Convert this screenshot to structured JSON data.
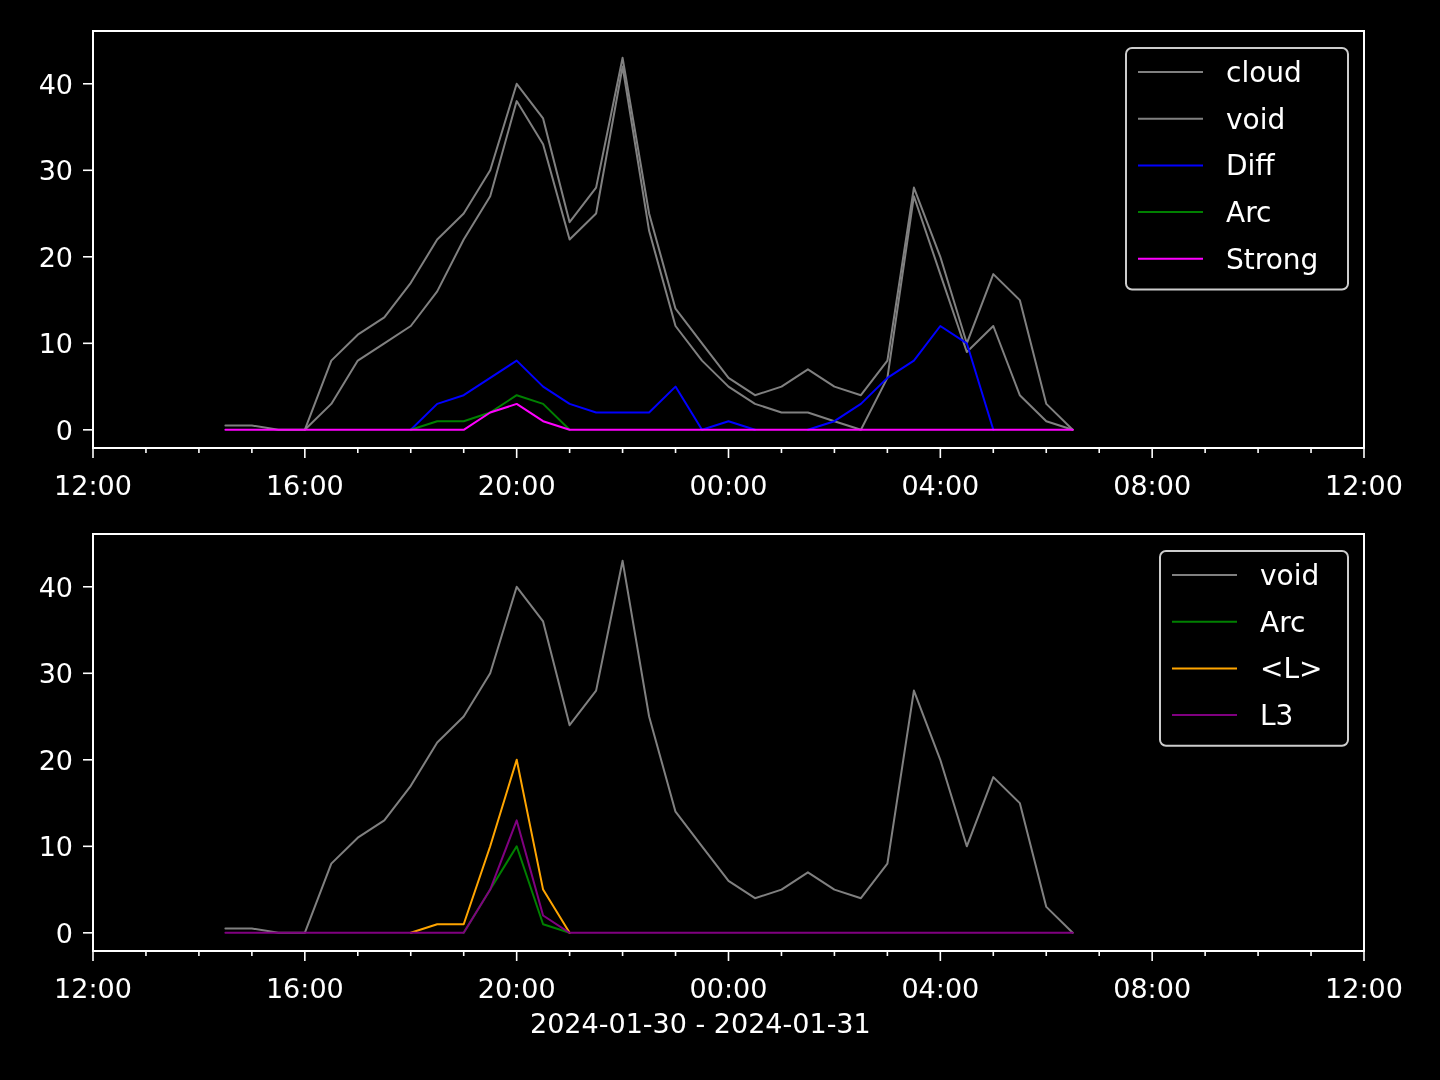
{
  "charts": [
    {
      "chart_data": {
        "type": "line",
        "ylim": [
          -2.1,
          46.1
        ],
        "legend": true,
        "categories": [
          "12:00",
          null,
          null,
          null,
          null,
          null,
          null,
          null,
          "16:00",
          null,
          null,
          null,
          null,
          null,
          null,
          null,
          "20:00",
          null,
          null,
          null,
          null,
          null,
          null,
          null,
          "00:00",
          null,
          null,
          null,
          null,
          null,
          null,
          null,
          "04:00",
          null,
          null,
          null,
          null,
          null,
          null,
          null,
          "08:00",
          null,
          null,
          null,
          null,
          null,
          null,
          null,
          "12:00"
        ],
        "yticks": [
          0,
          10,
          20,
          30,
          40
        ],
        "series": [
          {
            "name": "cloud",
            "color": "#808080",
            "values": [
              null,
              null,
              null,
              null,
              null,
              null,
              null,
              null,
              0,
              3,
              8,
              10,
              12,
              16,
              22,
              27,
              38,
              33,
              22,
              25,
              42,
              23,
              12,
              8,
              5,
              3,
              2,
              2,
              1,
              0,
              6,
              27,
              18,
              9,
              12,
              4,
              1,
              0,
              null,
              null,
              null,
              null,
              null,
              null,
              null,
              null,
              null,
              null,
              null
            ]
          },
          {
            "name": "void",
            "color": "#808080",
            "values": [
              null,
              null,
              null,
              null,
              null,
              0.5,
              0.5,
              0,
              0,
              8,
              11,
              13,
              17,
              22,
              25,
              30,
              40,
              36,
              24,
              28,
              43,
              25,
              14,
              10,
              6,
              4,
              5,
              7,
              5,
              4,
              8,
              28,
              20,
              10,
              18,
              15,
              3,
              0,
              null,
              null,
              null,
              null,
              null,
              null,
              null,
              null,
              null,
              null,
              null
            ]
          },
          {
            "name": "Diff",
            "color": "#0000ff",
            "values": [
              null,
              null,
              null,
              null,
              null,
              null,
              null,
              null,
              null,
              null,
              null,
              null,
              0,
              3,
              4,
              6,
              8,
              5,
              3,
              2,
              2,
              2,
              5,
              0,
              1,
              0,
              null,
              0,
              1,
              3,
              6,
              8,
              12,
              10,
              0,
              null,
              null,
              null,
              null,
              null,
              null,
              null,
              null,
              null,
              null,
              null,
              null,
              null,
              null
            ]
          },
          {
            "name": "Arc",
            "color": "#008000",
            "values": [
              null,
              null,
              null,
              null,
              null,
              null,
              null,
              null,
              null,
              null,
              null,
              null,
              0,
              1,
              1,
              2,
              4,
              3,
              0,
              null,
              null,
              null,
              null,
              null,
              null,
              null,
              null,
              null,
              null,
              null,
              null,
              null,
              null,
              null,
              null,
              null,
              null,
              null,
              null,
              null,
              null,
              null,
              null,
              null,
              null,
              null,
              null,
              null,
              null
            ]
          },
          {
            "name": "Strong",
            "color": "#ff00ff",
            "values": [
              null,
              null,
              null,
              null,
              null,
              0,
              0,
              0,
              0,
              0,
              0,
              0,
              0,
              0,
              0,
              2,
              3,
              1,
              0,
              0,
              0,
              0,
              0,
              0,
              0,
              0,
              0,
              0,
              0,
              0,
              0,
              0,
              0,
              0,
              0,
              0,
              0,
              0,
              null,
              null,
              null,
              null,
              null,
              null,
              null,
              null,
              null,
              null,
              null
            ]
          }
        ]
      }
    },
    {
      "chart_data": {
        "type": "line",
        "xlabel": "2024-01-30 - 2024-01-31",
        "ylim": [
          -2.1,
          46.1
        ],
        "legend": true,
        "categories": [
          "12:00",
          null,
          null,
          null,
          null,
          null,
          null,
          null,
          "16:00",
          null,
          null,
          null,
          null,
          null,
          null,
          null,
          "20:00",
          null,
          null,
          null,
          null,
          null,
          null,
          null,
          "00:00",
          null,
          null,
          null,
          null,
          null,
          null,
          null,
          "04:00",
          null,
          null,
          null,
          null,
          null,
          null,
          null,
          "08:00",
          null,
          null,
          null,
          null,
          null,
          null,
          null,
          "12:00"
        ],
        "yticks": [
          0,
          10,
          20,
          30,
          40
        ],
        "series": [
          {
            "name": "void",
            "color": "#808080",
            "values": [
              null,
              null,
              null,
              null,
              null,
              0.5,
              0.5,
              0,
              0,
              8,
              11,
              13,
              17,
              22,
              25,
              30,
              40,
              36,
              24,
              28,
              43,
              25,
              14,
              10,
              6,
              4,
              5,
              7,
              5,
              4,
              8,
              28,
              20,
              10,
              18,
              15,
              3,
              0,
              null,
              null,
              null,
              null,
              null,
              null,
              null,
              null,
              null,
              null,
              null
            ]
          },
          {
            "name": "Arc",
            "color": "#008000",
            "values": [
              null,
              null,
              null,
              null,
              null,
              null,
              null,
              null,
              null,
              null,
              null,
              null,
              null,
              null,
              0,
              5,
              10,
              1,
              0,
              null,
              null,
              null,
              null,
              null,
              null,
              null,
              null,
              null,
              null,
              null,
              null,
              null,
              null,
              null,
              null,
              null,
              null,
              null,
              null,
              null,
              null,
              null,
              null,
              null,
              null,
              null,
              null,
              null,
              null
            ]
          },
          {
            "name": "<L>",
            "color": "#ffa500",
            "values": [
              null,
              null,
              null,
              null,
              null,
              null,
              null,
              null,
              null,
              null,
              null,
              null,
              0,
              1,
              1,
              10,
              20,
              5,
              0,
              null,
              null,
              null,
              null,
              null,
              null,
              null,
              null,
              null,
              null,
              null,
              null,
              null,
              null,
              null,
              null,
              null,
              null,
              null,
              null,
              null,
              null,
              null,
              null,
              null,
              null,
              null,
              null,
              null,
              null
            ]
          },
          {
            "name": "L3",
            "color": "#800080",
            "values": [
              null,
              null,
              null,
              null,
              null,
              0,
              0,
              0,
              0,
              0,
              0,
              0,
              0,
              0,
              0,
              5,
              13,
              2,
              0,
              0,
              0,
              0,
              0,
              0,
              0,
              0,
              0,
              0,
              0,
              0,
              0,
              0,
              0,
              0,
              0,
              0,
              0,
              0,
              null,
              null,
              null,
              null,
              null,
              null,
              null,
              null,
              null,
              null,
              null
            ]
          }
        ]
      }
    }
  ]
}
